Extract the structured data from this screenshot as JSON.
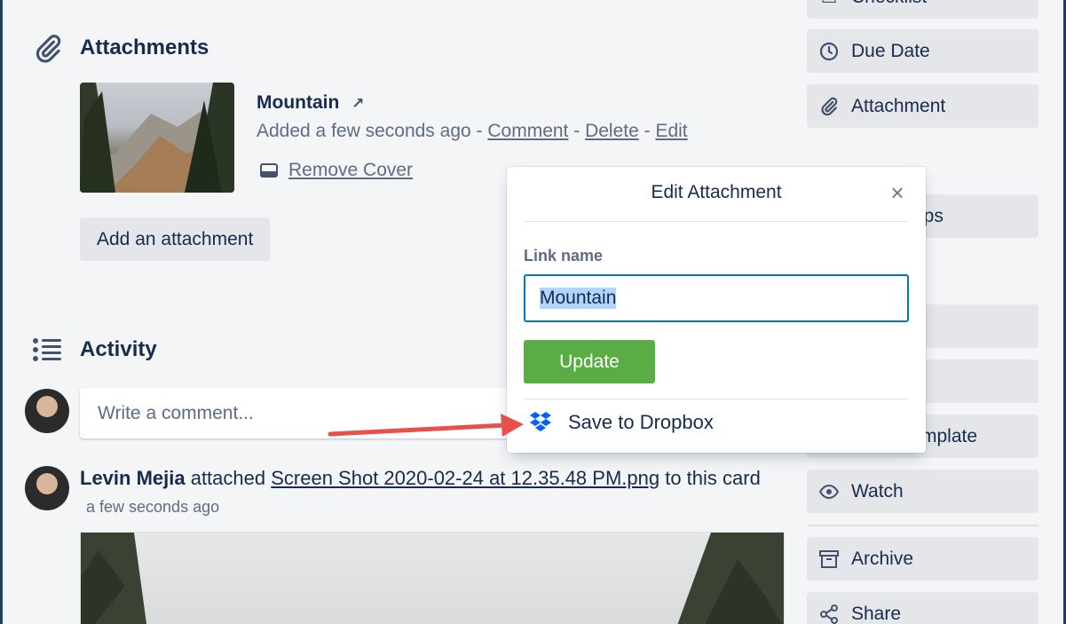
{
  "attachments": {
    "heading": "Attachments",
    "item": {
      "name": "Mountain",
      "added": "Added a few seconds ago",
      "sep": " - ",
      "comment": "Comment",
      "delete": "Delete",
      "edit": "Edit",
      "remove_cover": "Remove Cover"
    },
    "add_button": "Add an attachment"
  },
  "activity": {
    "heading": "Activity",
    "comment_placeholder": "Write a comment...",
    "entry": {
      "user": "Levin Mejia",
      "action": " attached ",
      "file": "Screen Shot 2020-02-24 at 12.35.48 PM.png",
      "suffix": " to this card",
      "time": "a few seconds ago"
    }
  },
  "sidebar": {
    "checklist": "Checklist",
    "due_date": "Due Date",
    "attachment": "Attachment",
    "power_ups": "Power-Ups",
    "template": "Make Template",
    "watch": "Watch",
    "archive": "Archive",
    "share": "Share"
  },
  "popover": {
    "title": "Edit Attachment",
    "close": "×",
    "link_label": "Link name",
    "link_value": "Mountain",
    "update": "Update",
    "save_dropbox": "Save to Dropbox"
  },
  "colors": {
    "accent_blue": "#0079bf",
    "update_green": "#5aac44",
    "annotation_red": "#e8504a",
    "dropbox_blue": "#0061fe"
  }
}
